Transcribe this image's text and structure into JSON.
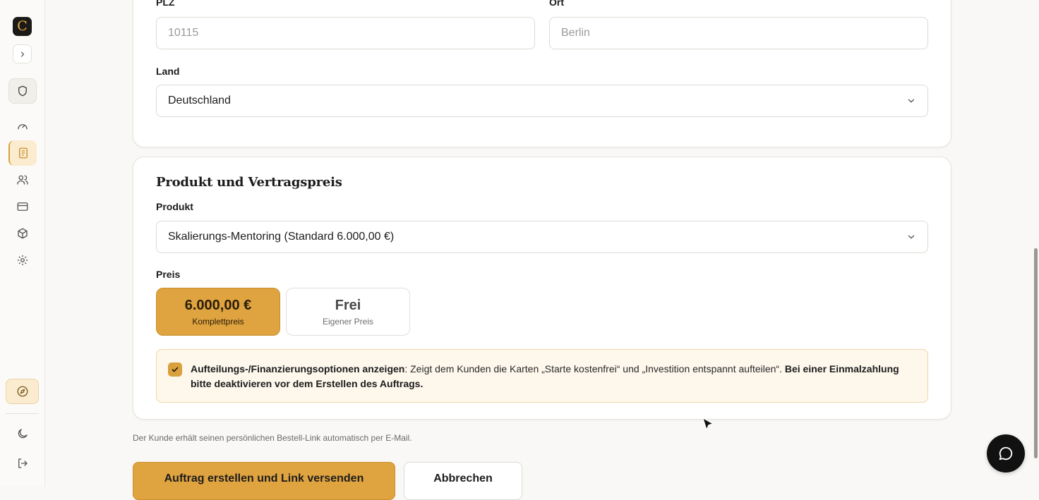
{
  "sidebar": {
    "logo_letter": "C",
    "items": [
      {
        "name": "shield",
        "icon": "shield-icon"
      },
      {
        "name": "dashboard",
        "icon": "gauge-icon"
      },
      {
        "name": "orders",
        "icon": "document-icon"
      },
      {
        "name": "customers",
        "icon": "users-icon"
      },
      {
        "name": "payments",
        "icon": "credit-card-icon"
      },
      {
        "name": "products",
        "icon": "box-icon"
      },
      {
        "name": "settings",
        "icon": "gear-icon"
      }
    ],
    "bottom_items": [
      {
        "name": "compass",
        "icon": "compass-icon"
      },
      {
        "name": "theme",
        "icon": "moon-icon"
      },
      {
        "name": "logout",
        "icon": "logout-icon"
      }
    ]
  },
  "address": {
    "zip_label": "PLZ",
    "zip_placeholder": "10115",
    "city_label": "Ort",
    "city_placeholder": "Berlin",
    "country_label": "Land",
    "country_value": "Deutschland"
  },
  "product_section": {
    "title": "Produkt und Vertragspreis",
    "product_label": "Produkt",
    "product_value": "Skalierungs-Mentoring (Standard 6.000,00 €)",
    "price_label": "Preis",
    "price_options": [
      {
        "main": "6.000,00 €",
        "sub": "Komplettpreis",
        "selected": true
      },
      {
        "main": "Frei",
        "sub": "Eigener Preis",
        "selected": false
      }
    ],
    "installment_notice": {
      "checked": true,
      "bold_lead": "Aufteilungs-/Finanzierungsoptionen anzeigen",
      "text": ": Zeigt dem Kunden die Karten „Starte kostenfrei“ und „Investition entspannt aufteilen“. ",
      "bold_tail": "Bei einer Einmalzahlung bitte deaktivieren vor dem Erstellen des Auftrags."
    }
  },
  "footnote": "Der Kunde erhält seinen persönlichen Bestell-Link automatisch per E-Mail.",
  "actions": {
    "submit_label": "Auftrag erstellen und Link versenden",
    "cancel_label": "Abbrechen"
  },
  "colors": {
    "accent": "#dfa33f",
    "accent_light": "#fbecd0",
    "notice_bg": "#fdf7ec"
  }
}
